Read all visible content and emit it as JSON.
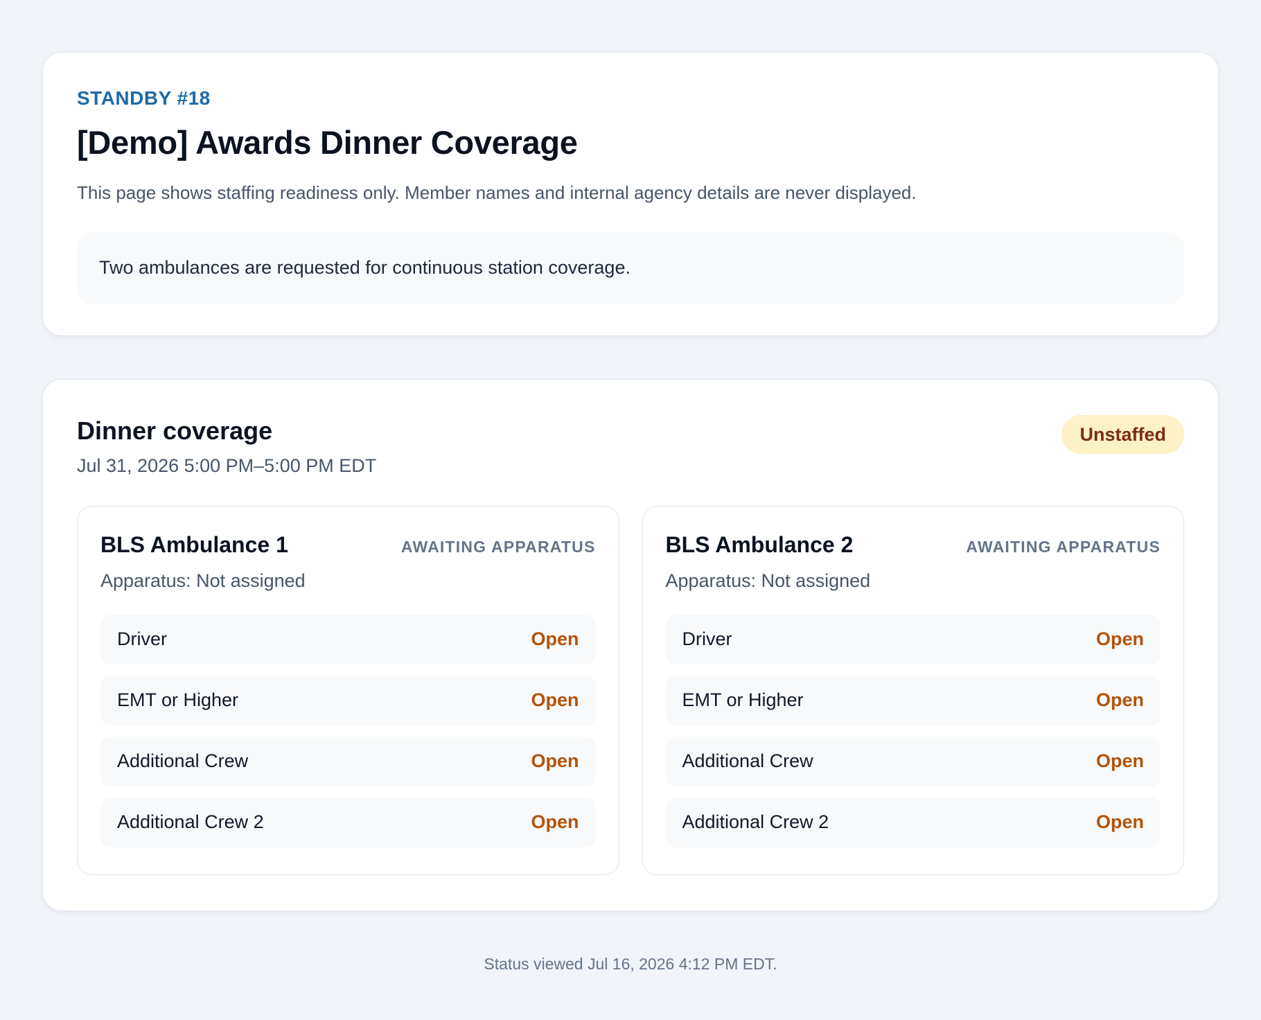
{
  "header": {
    "eyebrow": "STANDBY #18",
    "title": "[Demo] Awards Dinner Coverage",
    "privacy_note": "This page shows staffing readiness only. Member names and internal agency details are never displayed.",
    "notice": "Two ambulances are requested for continuous station coverage."
  },
  "shift": {
    "title": "Dinner coverage",
    "time": "Jul 31, 2026 5:00 PM–5:00 PM EDT",
    "status": "Unstaffed",
    "units": [
      {
        "name": "BLS Ambulance 1",
        "state": "AWAITING APPARATUS",
        "apparatus": "Apparatus: Not assigned",
        "roles": [
          {
            "name": "Driver",
            "status": "Open"
          },
          {
            "name": "EMT or Higher",
            "status": "Open"
          },
          {
            "name": "Additional Crew",
            "status": "Open"
          },
          {
            "name": "Additional Crew 2",
            "status": "Open"
          }
        ]
      },
      {
        "name": "BLS Ambulance 2",
        "state": "AWAITING APPARATUS",
        "apparatus": "Apparatus: Not assigned",
        "roles": [
          {
            "name": "Driver",
            "status": "Open"
          },
          {
            "name": "EMT or Higher",
            "status": "Open"
          },
          {
            "name": "Additional Crew",
            "status": "Open"
          },
          {
            "name": "Additional Crew 2",
            "status": "Open"
          }
        ]
      }
    ]
  },
  "footer": {
    "text": "Status viewed Jul 16, 2026 4:12 PM EDT."
  },
  "colors": {
    "background": "#f1f4f9",
    "eyebrow": "#1f6aa6",
    "badge_bg": "#fdf1c7",
    "badge_text": "#7c2d12",
    "open_status": "#b45309",
    "muted": "#64748b"
  }
}
